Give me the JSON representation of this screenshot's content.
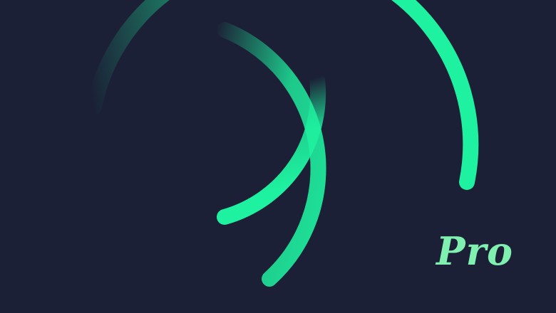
{
  "logo": {
    "icon_name": "swirl-arcs-logo",
    "badge_text": "Pro",
    "colors": {
      "background": "#1b2036",
      "accent": "#1ef2a0"
    }
  }
}
